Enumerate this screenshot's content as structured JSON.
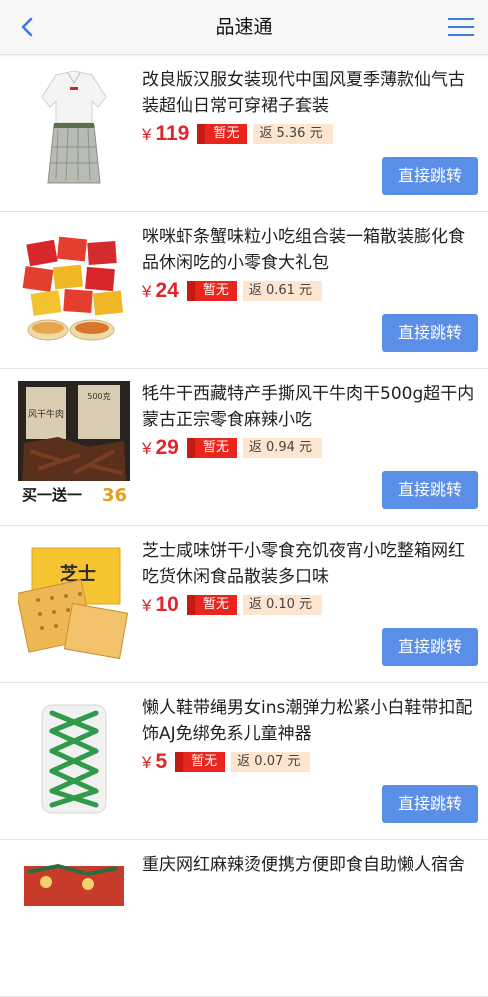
{
  "header": {
    "title": "品速通",
    "back_icon": "chevron-left-icon",
    "menu_icon": "hamburger-menu-icon"
  },
  "colors": {
    "accent_blue": "#5b8ee6",
    "price_red": "#e0252b",
    "rebate_bg": "#fde5d0"
  },
  "products": [
    {
      "name": "改良版汉服女装现代中国风夏季薄款仙气古装超仙日常可穿裙子套装",
      "currency": "¥",
      "price": "119",
      "coupon": "暂无",
      "rebate": "返 5.36 元",
      "button": "直接跳转"
    },
    {
      "name": "咪咪虾条蟹味粒小吃组合装一箱散装膨化食品休闲吃的小零食大礼包",
      "currency": "¥",
      "price": "24",
      "coupon": "暂无",
      "rebate": "返 0.61 元",
      "button": "直接跳转"
    },
    {
      "name": "牦牛干西藏特产手撕风干牛肉干500g超干内蒙古正宗零食麻辣小吃",
      "currency": "¥",
      "price": "29",
      "coupon": "暂无",
      "rebate": "返 0.94 元",
      "button": "直接跳转",
      "thumb_text": {
        "pack1": "风干牛肉",
        "pack2": "500克",
        "promo": "买一送一",
        "promo_num": "36"
      }
    },
    {
      "name": "芝士咸味饼干小零食充饥夜宵小吃整箱网红吃货休闲食品散装多口味",
      "currency": "¥",
      "price": "10",
      "coupon": "暂无",
      "rebate": "返 0.10 元",
      "button": "直接跳转",
      "thumb_text": {
        "box": "芝士"
      }
    },
    {
      "name": "懒人鞋带绳男女ins潮弹力松紧小白鞋带扣配饰AJ免绑免系儿童神器",
      "currency": "¥",
      "price": "5",
      "coupon": "暂无",
      "rebate": "返 0.07 元",
      "button": "直接跳转"
    },
    {
      "name": "重庆网红麻辣烫便携方便即食自助懒人宿舍"
    }
  ]
}
